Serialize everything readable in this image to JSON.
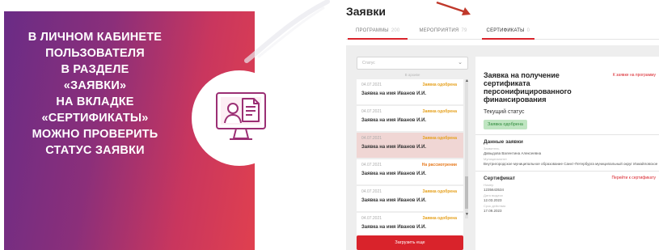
{
  "banner": {
    "lines": [
      "В ЛИЧНОМ КАБИНЕТЕ",
      "ПОЛЬЗОВАТЕЛЯ",
      "В РАЗДЕЛЕ",
      "«ЗАЯВКИ»",
      "НА ВКЛАДКЕ",
      "«СЕРТИФИКАТЫ»",
      "МОЖНО ПРОВЕРИТЬ",
      "СТАТУС ЗАЯВКИ"
    ],
    "icon": "monitor-document-user-icon",
    "colors": {
      "gradient_start": "#6a2c86",
      "gradient_end": "#e0404f",
      "accent": "#d9232b"
    }
  },
  "app": {
    "page_title": "Заявки",
    "tabs": [
      {
        "label": "ПРОГРАММЫ",
        "count": "200"
      },
      {
        "label": "МЕРОПРИЯТИЯ",
        "count": "79"
      },
      {
        "label": "СЕРТИФИКАТЫ",
        "count": "0"
      }
    ],
    "filter": {
      "value": "Статус",
      "hint": "В архиве"
    },
    "applications": [
      {
        "date": "04.07.2021",
        "status": "Заявка одобрена",
        "name": "Заявка на имя Иванов И.И."
      },
      {
        "date": "04.07.2021",
        "status": "Заявка одобрена",
        "name": "Заявка на имя Иванов И.И."
      },
      {
        "date": "04.07.2021",
        "status": "Заявка одобрена",
        "name": "Заявка на имя Иванов И.И."
      },
      {
        "date": "04.07.2021",
        "status": "На рассмотрении",
        "name": "Заявка на имя Иванов И.И."
      },
      {
        "date": "04.07.2021",
        "status": "Заявка одобрена",
        "name": "Заявка на имя Иванов И.И."
      },
      {
        "date": "04.07.2021",
        "status": "Заявка одобрена",
        "name": "Заявка на имя Иванов И.И."
      }
    ],
    "load_more": "Загрузить еще",
    "detail": {
      "title": "Заявка на получение сертификата персонифицированного финансирования",
      "program_link": "К заявке на программу",
      "current_status_label": "Текущий статус",
      "current_status": "Заявка одобрена",
      "data_title": "Данные заявки",
      "applicant_label": "Заявитель",
      "applicant": "Давыдова Валентина Алексеевна",
      "municipality_label": "Муниципалитет",
      "municipality": "Внутригородское муниципальное образование Санкт-Петербурга муниципальный округ Измайловское",
      "certificate_title": "Сертификат",
      "certificate_link": "Перейти к сертификату",
      "number_label": "Номер",
      "number": "1235643534",
      "issue_label": "Дата выдачи",
      "issue_date": "12.03.2023",
      "expiry_label": "Срок действия",
      "expiry_date": "17.09.2023"
    }
  }
}
